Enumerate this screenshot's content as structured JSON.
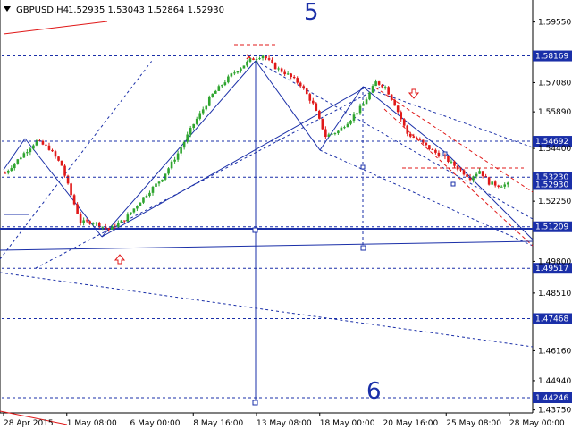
{
  "header": {
    "symbol": "GBPUSD,H4",
    "ohlc": "1.52935 1.53043 1.52864 1.52930"
  },
  "wave_labels": [
    "5",
    "6"
  ],
  "colors": {
    "bull": "#2fa52f",
    "bear": "#e01818",
    "lines": "#1a2fa8",
    "level_bg": "#1a2fa8",
    "current_bg": "#1a2fa8"
  },
  "chart_data": {
    "type": "candlestick",
    "title": "GBPUSD,H4",
    "ylim": [
      1.437,
      1.603
    ],
    "y_ticks": [
      "1.59550",
      "1.57080",
      "1.55890",
      "1.54400",
      "1.52250",
      "1.49800",
      "1.48510",
      "1.46160",
      "1.44940",
      "1.43750"
    ],
    "x_ticks": [
      "28 Apr 2015",
      "1 May 08:00",
      "6 May 00:00",
      "8 May 16:00",
      "13 May 08:00",
      "18 May 00:00",
      "20 May 16:00",
      "25 May 08:00",
      "28 May 00:00"
    ],
    "levels": [
      "1.58169",
      "1.54692",
      "1.53230",
      "1.51209",
      "1.49517",
      "1.47468",
      "1.44246"
    ],
    "current_price": "1.52930",
    "close_path": [
      [
        0,
        1.534
      ],
      [
        6,
        1.542
      ],
      [
        10,
        1.547
      ],
      [
        14,
        1.544
      ],
      [
        18,
        1.537
      ],
      [
        21,
        1.525
      ],
      [
        24,
        1.514
      ],
      [
        28,
        1.514
      ],
      [
        33,
        1.511
      ],
      [
        38,
        1.515
      ],
      [
        44,
        1.524
      ],
      [
        50,
        1.532
      ],
      [
        55,
        1.542
      ],
      [
        60,
        1.554
      ],
      [
        66,
        1.566
      ],
      [
        72,
        1.574
      ],
      [
        78,
        1.58
      ],
      [
        82,
        1.582
      ],
      [
        86,
        1.577
      ],
      [
        90,
        1.574
      ],
      [
        94,
        1.57
      ],
      [
        98,
        1.562
      ],
      [
        102,
        1.549
      ],
      [
        106,
        1.551
      ],
      [
        110,
        1.556
      ],
      [
        114,
        1.562
      ],
      [
        118,
        1.571
      ],
      [
        121,
        1.569
      ],
      [
        124,
        1.562
      ],
      [
        128,
        1.55
      ],
      [
        132,
        1.547
      ],
      [
        136,
        1.543
      ],
      [
        140,
        1.54
      ],
      [
        144,
        1.536
      ],
      [
        148,
        1.532
      ],
      [
        151,
        1.535
      ],
      [
        154,
        1.53
      ],
      [
        157,
        1.529
      ],
      [
        160,
        1.5293
      ]
    ]
  }
}
